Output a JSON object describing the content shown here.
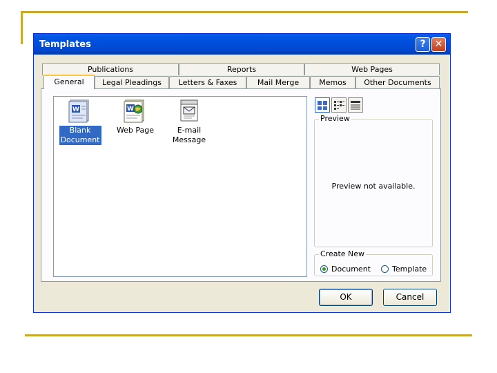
{
  "dialog": {
    "title": "Templates",
    "help_glyph": "?",
    "close_glyph": "✕"
  },
  "tabs_back": [
    {
      "label": "Publications"
    },
    {
      "label": "Reports"
    },
    {
      "label": "Web Pages"
    }
  ],
  "tabs_front": [
    {
      "label": "General",
      "active": true
    },
    {
      "label": "Legal Pleadings"
    },
    {
      "label": "Letters & Faxes"
    },
    {
      "label": "Mail Merge"
    },
    {
      "label": "Memos"
    },
    {
      "label": "Other Documents"
    }
  ],
  "files": [
    {
      "label_line1": "Blank",
      "label_line2": "Document",
      "icon": "word-document-icon",
      "selected": true
    },
    {
      "label_line1": "Web Page",
      "label_line2": "",
      "icon": "web-page-icon",
      "selected": false
    },
    {
      "label_line1": "E-mail",
      "label_line2": "Message",
      "icon": "email-message-icon",
      "selected": false
    }
  ],
  "view_buttons": [
    "large-icons-view-icon",
    "list-view-icon",
    "details-view-icon"
  ],
  "preview": {
    "label": "Preview",
    "message": "Preview not available."
  },
  "create_new": {
    "label": "Create New",
    "options": [
      {
        "label": "Document",
        "checked": true
      },
      {
        "label": "Template",
        "checked": false
      }
    ]
  },
  "buttons": {
    "ok": "OK",
    "cancel": "Cancel"
  },
  "colors": {
    "title_bar": "#0054e3",
    "dialog_bg": "#ece9d8",
    "selection": "#316ac5",
    "slide_accent": "#c8a92a"
  }
}
